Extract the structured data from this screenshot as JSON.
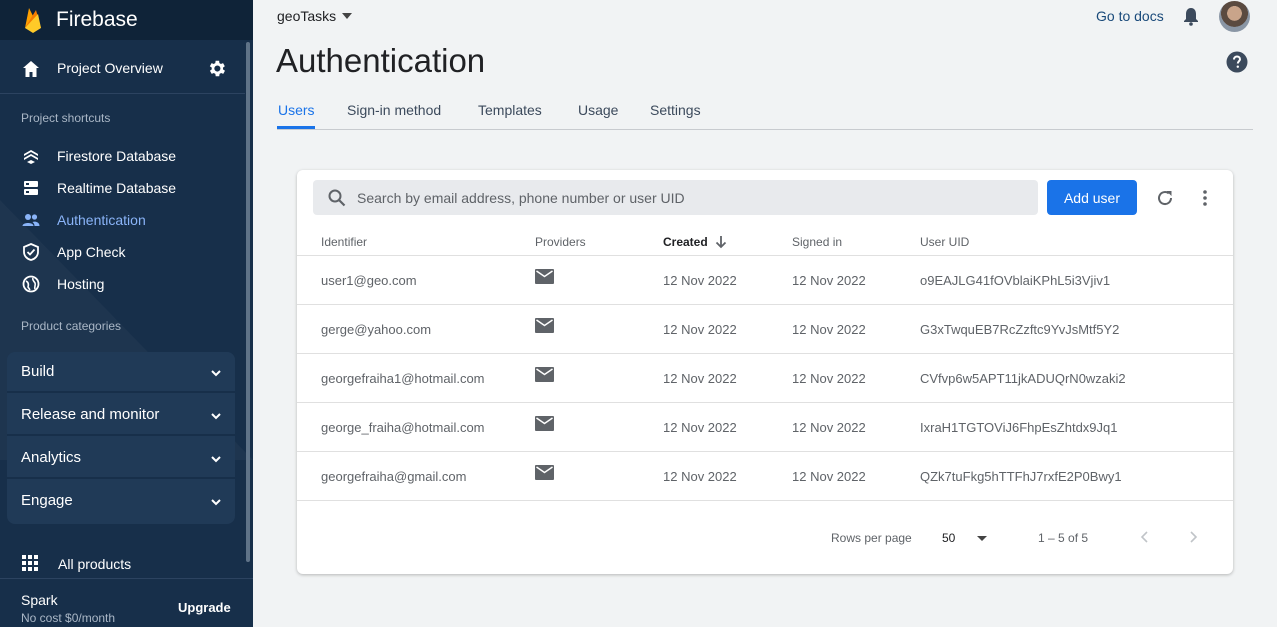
{
  "sidebar": {
    "brand": "Firebase",
    "project_overview": "Project Overview",
    "shortcuts_title": "Project shortcuts",
    "shortcuts": [
      {
        "label": "Firestore Database",
        "icon": "firestore-icon",
        "active": false
      },
      {
        "label": "Realtime Database",
        "icon": "database-icon",
        "active": false
      },
      {
        "label": "Authentication",
        "icon": "users-icon",
        "active": true
      },
      {
        "label": "App Check",
        "icon": "shield-icon",
        "active": false
      },
      {
        "label": "Hosting",
        "icon": "globe-icon",
        "active": false
      }
    ],
    "categories_title": "Product categories",
    "categories": [
      {
        "label": "Build"
      },
      {
        "label": "Release and monitor"
      },
      {
        "label": "Analytics"
      },
      {
        "label": "Engage"
      }
    ],
    "all_products": "All products",
    "plan": {
      "name": "Spark",
      "cost": "No cost $0/month",
      "upgrade": "Upgrade"
    }
  },
  "header": {
    "project": "geoTasks",
    "docs": "Go to docs"
  },
  "page": {
    "title": "Authentication",
    "tabs": [
      {
        "label": "Users",
        "active": true
      },
      {
        "label": "Sign-in method",
        "active": false
      },
      {
        "label": "Templates",
        "active": false
      },
      {
        "label": "Usage",
        "active": false
      },
      {
        "label": "Settings",
        "active": false
      }
    ]
  },
  "users": {
    "search_placeholder": "Search by email address, phone number or user UID",
    "add_user": "Add user",
    "columns": {
      "identifier": "Identifier",
      "providers": "Providers",
      "created": "Created",
      "signed_in": "Signed in",
      "uid": "User UID"
    },
    "rows": [
      {
        "identifier": "user1@geo.com",
        "provider": "mail-icon",
        "created": "12 Nov 2022",
        "signed_in": "12 Nov 2022",
        "uid": "o9EAJLG41fOVblaiKPhL5i3Vjiv1"
      },
      {
        "identifier": "gerge@yahoo.com",
        "provider": "mail-icon",
        "created": "12 Nov 2022",
        "signed_in": "12 Nov 2022",
        "uid": "G3xTwquEB7RcZzftc9YvJsMtf5Y2"
      },
      {
        "identifier": "georgefraiha1@hotmail.com",
        "provider": "mail-icon",
        "created": "12 Nov 2022",
        "signed_in": "12 Nov 2022",
        "uid": "CVfvp6w5APT11jkADUQrN0wzaki2"
      },
      {
        "identifier": "george_fraiha@hotmail.com",
        "provider": "mail-icon",
        "created": "12 Nov 2022",
        "signed_in": "12 Nov 2022",
        "uid": "IxraH1TGTOViJ6FhpEsZhtdx9Jq1"
      },
      {
        "identifier": "georgefraiha@gmail.com",
        "provider": "mail-icon",
        "created": "12 Nov 2022",
        "signed_in": "12 Nov 2022",
        "uid": "QZk7tuFkg5hTTFhJ7rxfE2P0Bwy1"
      }
    ],
    "pagination": {
      "rows_per_page_label": "Rows per page",
      "rows_per_page": "50",
      "range": "1 – 5 of 5"
    }
  },
  "colors": {
    "sidebar_bg": "#172f4a",
    "accent": "#1a73e8",
    "active_nav": "#8ab4f8"
  }
}
